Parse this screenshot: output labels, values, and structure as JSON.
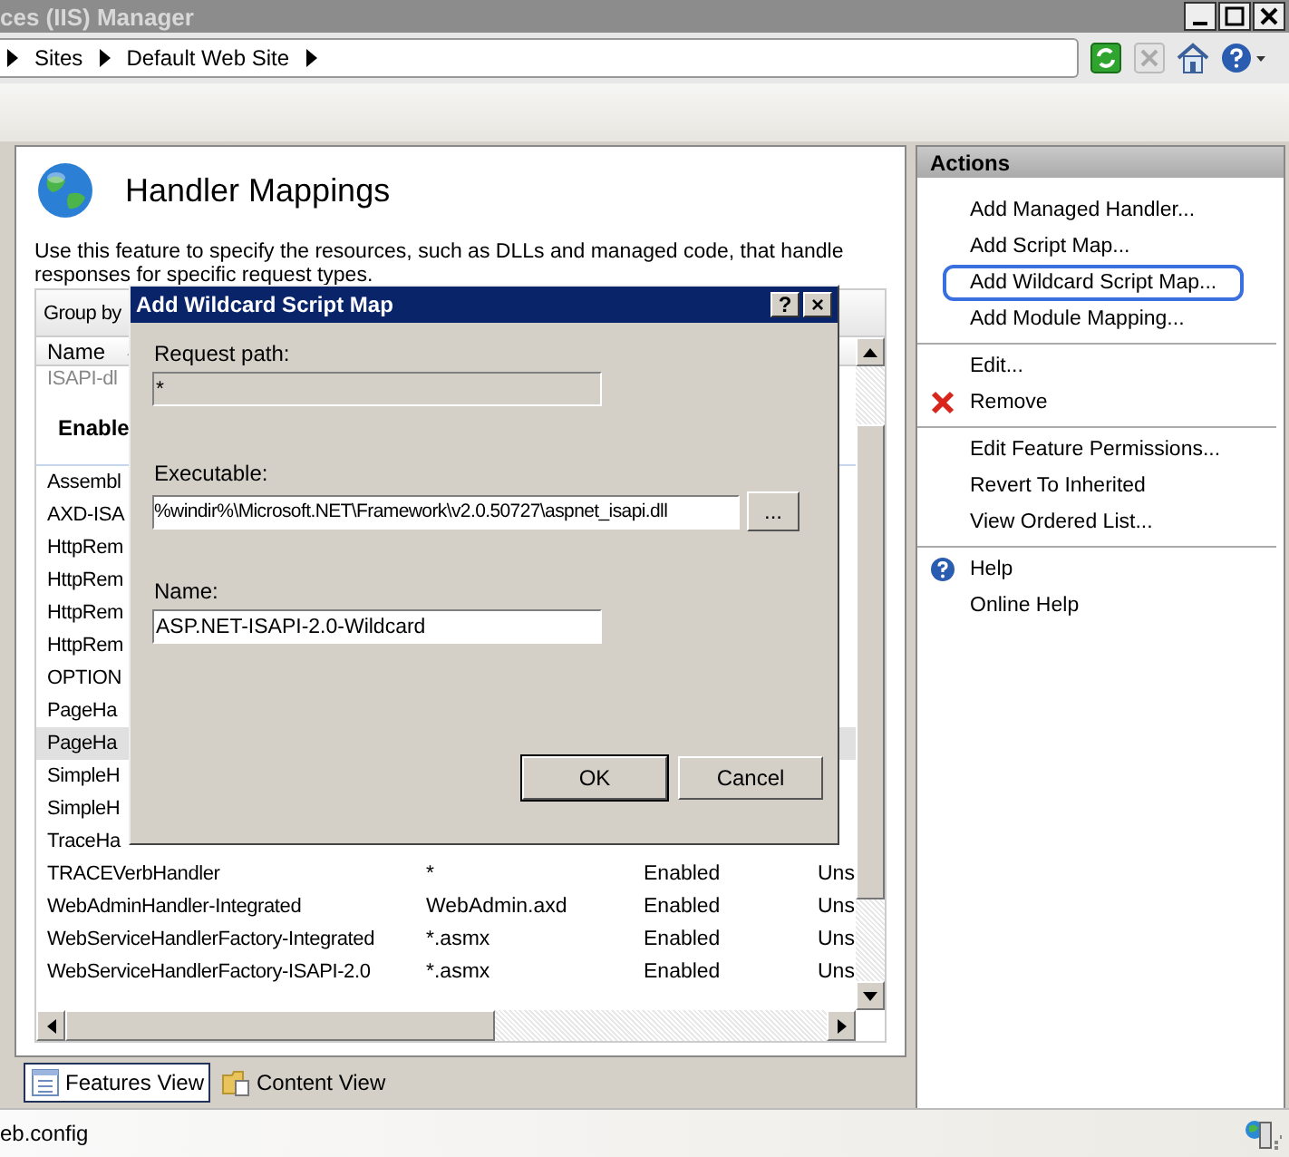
{
  "window": {
    "title": "ces (IIS) Manager"
  },
  "breadcrumb": [
    "Sites",
    "Default Web Site"
  ],
  "feature": {
    "title": "Handler Mappings",
    "description": "Use this feature to specify the resources, such as DLLs and managed code, that handle responses for specific request types."
  },
  "table": {
    "group_by": "Group by",
    "columns": [
      "Name"
    ],
    "rows": [
      {
        "kind": "dimmed",
        "name": "ISAPI-dl",
        "selected": false
      },
      {
        "kind": "group",
        "name": "Enable",
        "selected": false
      },
      {
        "kind": "row",
        "name": "Assembl",
        "selected": false
      },
      {
        "kind": "row",
        "name": "AXD-ISA",
        "selected": false
      },
      {
        "kind": "row",
        "name": "HttpRem",
        "selected": false
      },
      {
        "kind": "row",
        "name": "HttpRem",
        "selected": false
      },
      {
        "kind": "row",
        "name": "HttpRem",
        "selected": false
      },
      {
        "kind": "row",
        "name": "HttpRem",
        "selected": false
      },
      {
        "kind": "row",
        "name": "OPTION",
        "selected": false
      },
      {
        "kind": "row",
        "name": "PageHa",
        "selected": false
      },
      {
        "kind": "row",
        "name": "PageHa",
        "selected": true
      },
      {
        "kind": "row",
        "name": "SimpleH",
        "selected": false
      },
      {
        "kind": "row",
        "name": "SimpleH",
        "selected": false
      },
      {
        "kind": "row",
        "name": "TraceHa",
        "selected": false
      },
      {
        "kind": "row",
        "name": "TRACEVerbHandler",
        "path": "*",
        "state": "Enabled",
        "column_4": "Uns",
        "selected": false
      },
      {
        "kind": "row",
        "name": "WebAdminHandler-Integrated",
        "path": "WebAdmin.axd",
        "state": "Enabled",
        "column_4": "Uns",
        "selected": false
      },
      {
        "kind": "row",
        "name": "WebServiceHandlerFactory-Integrated",
        "path": "*.asmx",
        "state": "Enabled",
        "column_4": "Uns",
        "selected": false
      },
      {
        "kind": "row",
        "name": "WebServiceHandlerFactory-ISAPI-2.0",
        "path": "*.asmx",
        "state": "Enabled",
        "column_4": "Uns",
        "selected": false
      }
    ]
  },
  "view_tabs": [
    {
      "label": "Features View",
      "selected": true
    },
    {
      "label": "Content View",
      "selected": false
    }
  ],
  "actions": {
    "title": "Actions",
    "groups": [
      [
        {
          "label": "Add Managed Handler...",
          "circled": false
        },
        {
          "label": "Add Script Map...",
          "circled": false
        },
        {
          "label": "Add Wildcard Script Map...",
          "circled": true
        },
        {
          "label": "Add Module Mapping...",
          "circled": false
        }
      ],
      [
        {
          "label": "Edit...",
          "circled": false
        },
        {
          "label": "Remove",
          "kind": "remove",
          "circled": false
        }
      ],
      [
        {
          "label": "Edit Feature Permissions...",
          "circled": false
        },
        {
          "label": "Revert To Inherited",
          "circled": false
        },
        {
          "label": "View Ordered List...",
          "circled": false
        }
      ],
      [
        {
          "label": "Help",
          "kind": "help",
          "circled": false
        },
        {
          "label": "Online Help",
          "circled": false
        }
      ]
    ]
  },
  "dialog": {
    "title": "Add Wildcard Script Map",
    "help": "?",
    "close": "×",
    "fields": [
      {
        "label": "Request path:",
        "value": "*",
        "disabled": true,
        "browse": false
      },
      {
        "label": "Executable:",
        "value": "%windir%\\Microsoft.NET\\Framework\\v2.0.50727\\aspnet_isapi.dll",
        "disabled": false,
        "browse": true
      },
      {
        "label": "Name:",
        "value": "ASP.NET-ISAPI-2.0-Wildcard",
        "disabled": false,
        "browse": false
      }
    ],
    "browse_label": "...",
    "buttons": [
      {
        "label": "OK",
        "default": true
      },
      {
        "label": "Cancel",
        "default": false
      }
    ]
  },
  "status_bar": {
    "text": "eb.config"
  }
}
